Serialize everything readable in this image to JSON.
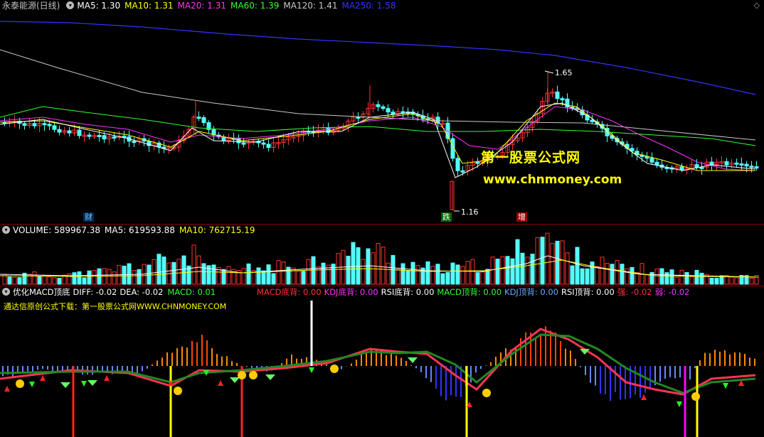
{
  "main": {
    "title": "永泰能源(日线)",
    "ma": [
      {
        "label": "MA5: 1.30",
        "color": "#ffffff"
      },
      {
        "label": "MA10: 1.31",
        "color": "#ffff00"
      },
      {
        "label": "MA20: 1.31",
        "color": "#ff33ff"
      },
      {
        "label": "MA60: 1.39",
        "color": "#33ff33"
      },
      {
        "label": "MA120: 1.41",
        "color": "#c8c8c8"
      },
      {
        "label": "MA250: 1.58",
        "color": "#3333ff"
      }
    ],
    "high_label": "1.65",
    "low_label": "1.16",
    "tags": [
      {
        "text": "财",
        "color": "#6fd0ff",
        "bg": "#003366"
      },
      {
        "text": "跌",
        "color": "#ffffff",
        "bg": "#006600"
      },
      {
        "text": "增",
        "color": "#ffffff",
        "bg": "#990000"
      }
    ],
    "watermark_cn": "第一股票公式网",
    "watermark_url": "www.chnmoney.com"
  },
  "volume": {
    "items": [
      {
        "label": "VOLUME: 589967.38",
        "color": "#ffffff"
      },
      {
        "label": "MA5: 619593.88",
        "color": "#ffffff"
      },
      {
        "label": "MA10: 762715.19",
        "color": "#ffff00"
      }
    ]
  },
  "macd": {
    "items": [
      {
        "label": "优化MACD顶底",
        "color": "#ffffff"
      },
      {
        "label": "DIFF: -0.02",
        "color": "#ffffff"
      },
      {
        "label": "DEA: -0.02",
        "color": "#ffffff"
      },
      {
        "label": "MACD: 0.01",
        "color": "#33ff33"
      },
      {
        "label": "MACD底背: 0.00",
        "color": "#ff3333"
      },
      {
        "label": "KDJ底背: 0.00",
        "color": "#ff33ff"
      },
      {
        "label": "RSI底背: 0.00",
        "color": "#ffffff"
      },
      {
        "label": "MACD顶背: 0.00",
        "color": "#33ff33"
      },
      {
        "label": "KDJ顶背: 0.00",
        "color": "#6fa8ff"
      },
      {
        "label": "RSI顶背: 0.00",
        "color": "#ffffff"
      },
      {
        "label": "强: -0.02",
        "color": "#ff3333"
      },
      {
        "label": "弱: -0.02",
        "color": "#ff33ff"
      }
    ],
    "subtitle": "通达信原创公式下载：第一股票公式网WWW.CHNMONEY.COM"
  },
  "colors": {
    "up": "#ff3232",
    "down": "#54ffff",
    "sep": "#8b0000"
  }
}
